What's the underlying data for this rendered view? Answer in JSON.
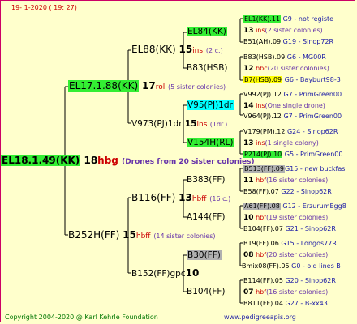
{
  "header": {
    "date": "19-  1-2020  ( 19:  27)"
  },
  "root": {
    "id": "EL18.1.49(KK)",
    "num": "18",
    "sub": "hbg",
    "note": "(Drones from 20 sister colonies)"
  },
  "gen1": {
    "top": {
      "id": "EL17.1.88(KK)",
      "num": "17",
      "sub": "rol",
      "note": "(5 sister colonies)"
    },
    "bottom": {
      "id": "B252H(FF)",
      "num": "15",
      "sub": "hbff",
      "note": "(14 sister colonies)"
    }
  },
  "gen2": [
    {
      "id": "EL88(KK)",
      "num": "15",
      "sub": "ins",
      "note": "(2 c.)"
    },
    {
      "id": "V973(PJ)1dr",
      "num": "15",
      "sub": "ins",
      "note": "(1dr.)"
    },
    {
      "id": "B116(FF)",
      "num": "13",
      "sub": "hbff",
      "note": "(16 c.)"
    },
    {
      "id": "B152(FF)gpc",
      "num": "10",
      "sub": "",
      "note": ""
    }
  ],
  "gen3": [
    {
      "id": "EL84(KK)"
    },
    {
      "id": "B83(HSB)"
    },
    {
      "id": "V95(PJ)1dr"
    },
    {
      "id": "V154H(RL)"
    },
    {
      "id": "B383(FF)"
    },
    {
      "id": "A144(FF)"
    },
    {
      "id": "B30(FF)"
    },
    {
      "id": "B104(FF)"
    }
  ],
  "gen4": [
    {
      "id": "EL1(KK).11",
      "tag": "G9 - not registe",
      "num": "13",
      "sub": "ins",
      "note": "(2 sister colonies)",
      "id2": "B51(AH).09",
      "tag2": "G19 - Sinop72R"
    },
    {
      "id": "B83(HSB).09",
      "tag": "G6 - MG00R",
      "num": "12",
      "sub": "hbc",
      "note": "(20 sister colonies)",
      "id2": "B7(HSB).09",
      "tag2": "G6 - Bayburt98-3"
    },
    {
      "id": "V992(PJ).12",
      "tag": "G7 - PrimGreen00",
      "num": "14",
      "sub": "ins",
      "note": "(One single drone)",
      "id2": "V964(PJ).12",
      "tag2": "G7 - PrimGreen00"
    },
    {
      "id": "V179(PM).12",
      "tag": "G24 - Sinop62R",
      "num": "13",
      "sub": "ins",
      "note": "(1 single colony)",
      "id2": "P214(PJ).10",
      "tag2": "G5 - PrimGreen00"
    },
    {
      "id": "B513(FF).09",
      "tag": "G15 - new buckfas",
      "num": "11",
      "sub": "hbf",
      "note": "(16 sister colonies)",
      "id2": "B58(FF).07",
      "tag2": "G22 - Sinop62R"
    },
    {
      "id": "A61(FF).08",
      "tag": "G12 - ErzurumEgg8",
      "num": "10",
      "sub": "hbf",
      "note": "(19 sister colonies)",
      "id2": "B104(FF).07",
      "tag2": "G21 - Sinop62R"
    },
    {
      "id": "B19(FF).06",
      "tag": "G15 - Longos77R",
      "num": "08",
      "sub": "hbf",
      "note": "(20 sister colonies)",
      "id2": "Bmix08(FF).05",
      "tag2": "G0 - old lines B"
    },
    {
      "id": "B114(FF).05",
      "tag": "G20 - Sinop62R",
      "num": "07",
      "sub": "hbf",
      "note": "(16 sister colonies)",
      "id2": "B811(FF).04",
      "tag2": "G27 - B-xx43"
    }
  ],
  "footer": {
    "copyright": "Copyright 2004-2020 @ Karl Kehrle Foundation",
    "website": "www.pedigreeapis.org"
  },
  "colors": {
    "background": "#ffffcc",
    "green": "#33ee33",
    "cyan": "#00ffff",
    "gray": "#b0b0b0",
    "yellow": "#ffff00",
    "red": "#cc0000",
    "blue": "#1a1aa6"
  }
}
